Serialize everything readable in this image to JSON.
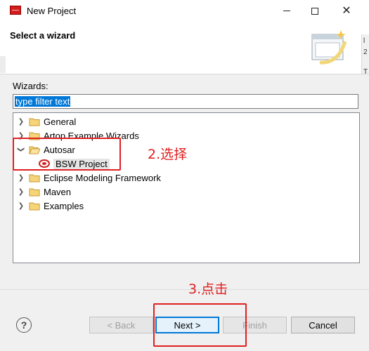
{
  "window": {
    "title": "New Project"
  },
  "header": {
    "title": "Select a wizard",
    "edge_chars": [
      "l",
      "2",
      "T"
    ]
  },
  "wizards": {
    "label": "Wizards:",
    "filter_value": "type filter text"
  },
  "tree": {
    "items": [
      {
        "label": "General",
        "expanded": false,
        "icon": "folder-icon"
      },
      {
        "label": "Artop Example Wizards",
        "expanded": false,
        "icon": "folder-icon"
      },
      {
        "label": "Autosar",
        "expanded": true,
        "icon": "folder-open-icon"
      },
      {
        "label": "BSW Project",
        "child": true,
        "selected": true,
        "icon": "bsw-project-icon"
      },
      {
        "label": "Eclipse Modeling Framework",
        "expanded": false,
        "icon": "folder-icon"
      },
      {
        "label": "Maven",
        "expanded": false,
        "icon": "folder-icon"
      },
      {
        "label": "Examples",
        "expanded": false,
        "icon": "folder-icon"
      }
    ]
  },
  "buttons": {
    "help": "?",
    "back": "< Back",
    "next": "Next >",
    "finish": "Finish",
    "cancel": "Cancel"
  },
  "annotations": {
    "select": "2.选择",
    "click": "3.点击",
    "color": "#e02020"
  }
}
